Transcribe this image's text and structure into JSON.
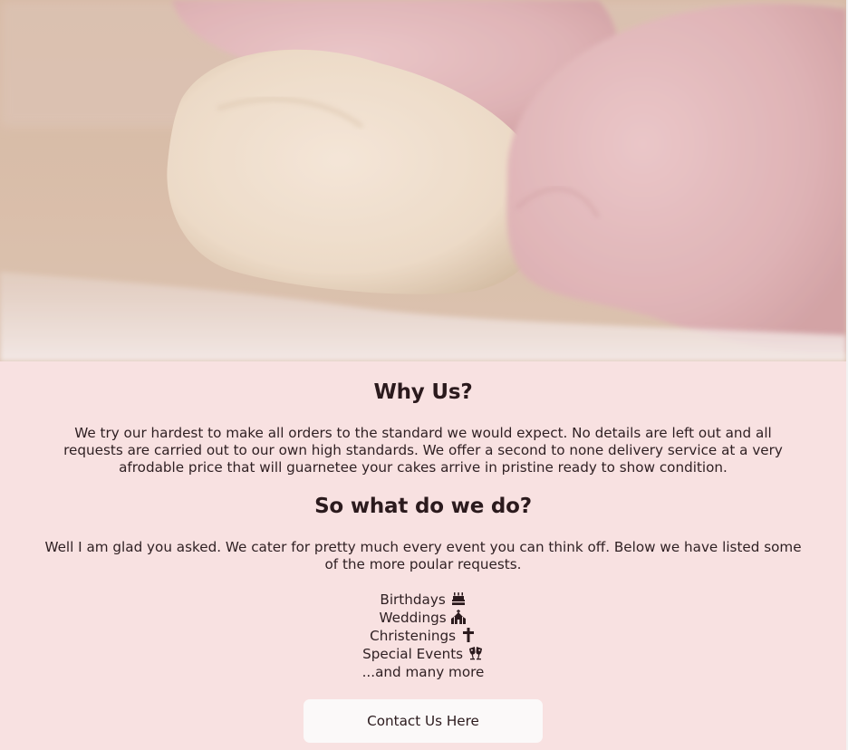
{
  "hero": {
    "image_description_icon": "dough-kneading-photo"
  },
  "why_us": {
    "title": "Why Us?",
    "text": "We try our hardest to make all orders to the standard we would expect. No details are left out and all requests are carried out to our own high standards. We offer a second to none delivery service at a very afrodable price that will guarnetee your cakes arrive in pristine ready to show condition."
  },
  "what_we_do": {
    "title": "So what do we do?",
    "text": "Well I am glad you asked. We cater for pretty much every event you can think off. Below we have listed some of the more poular requests."
  },
  "events": [
    {
      "label": "Birthdays",
      "icon": "birthday-cake-icon"
    },
    {
      "label": "Weddings",
      "icon": "wedding-chapel-icon"
    },
    {
      "label": "Christenings",
      "icon": "cross-icon"
    },
    {
      "label": "Special Events",
      "icon": "clinking-glasses-icon"
    },
    {
      "label": "...and many more",
      "icon": ""
    }
  ],
  "contact_button": {
    "label": "Contact Us Here"
  },
  "colors": {
    "background": "#f8e1e1",
    "text": "#2e1f22",
    "button_bg": "#fbf9f9"
  }
}
